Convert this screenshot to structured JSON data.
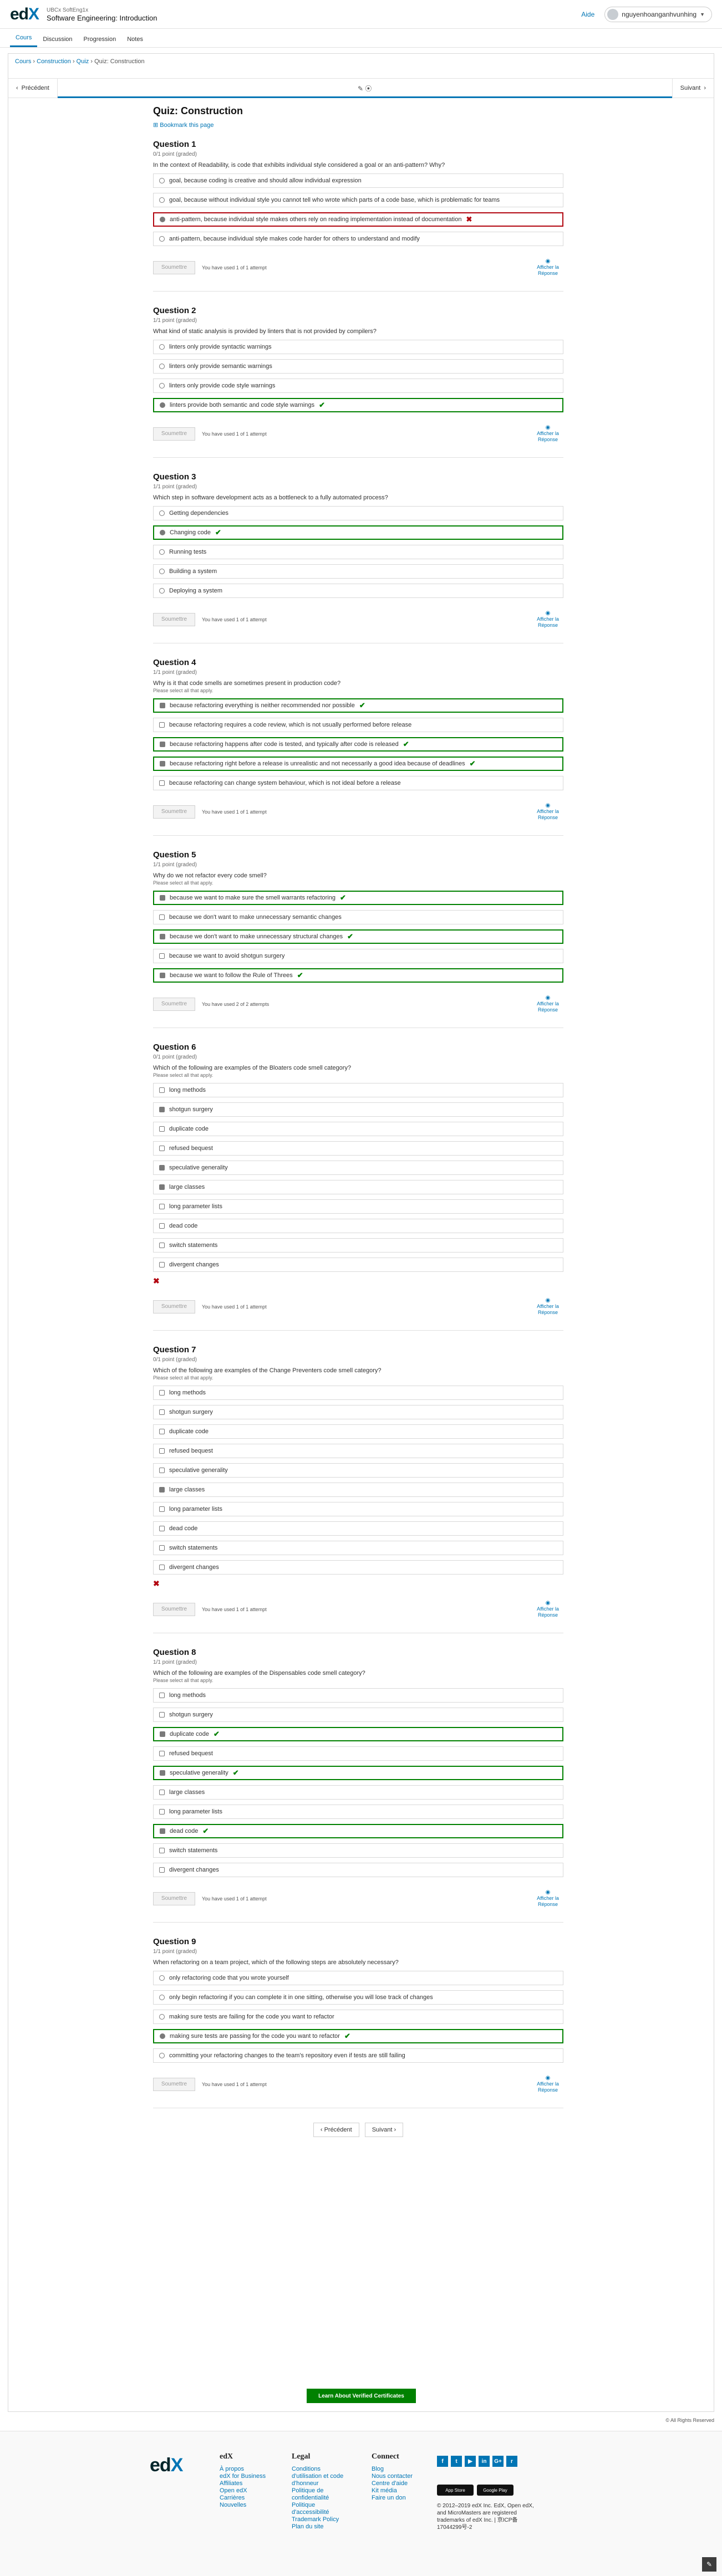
{
  "header": {
    "org": "UBCx SoftEng1x",
    "course_name": "Software Engineering: Introduction",
    "help": "Aide",
    "username": "nguyenhoanganhvunhing"
  },
  "course_tabs": [
    "Cours",
    "Discussion",
    "Progression",
    "Notes"
  ],
  "breadcrumb": [
    "Cours",
    "Construction",
    "Quiz",
    "Quiz: Construction"
  ],
  "sequence": {
    "prev": "Précédent",
    "next": "Suivant",
    "mid_icon": "✎ ⦿"
  },
  "unit": {
    "title": "Quiz: Construction",
    "bookmark": "Bookmark this page"
  },
  "common": {
    "submit": "Soumettre",
    "show_answer": "Afficher la Réponse",
    "attempts_1": "You have used 1 of 1 attempt",
    "attempts_2": "You have used 2 of 2 attempts"
  },
  "questions": [
    {
      "title": "Question 1",
      "points": "0/1 point (graded)",
      "text": "In the context of Readability, is code that exhibits individual style considered a goal or an anti-pattern? Why?",
      "hint": "",
      "kind": "radio",
      "attempts_key": "attempts_1",
      "trailing_x": false,
      "options": [
        {
          "label": "goal, because coding is creative and should allow individual expression",
          "state": ""
        },
        {
          "label": "goal, because without individual style you cannot tell who wrote which parts of a code base, which is problematic for teams",
          "state": ""
        },
        {
          "label": "anti-pattern, because individual style makes others rely on reading implementation instead of documentation",
          "state": "bad",
          "sel": true
        },
        {
          "label": "anti-pattern, because individual style makes code harder for others to understand and modify",
          "state": ""
        }
      ]
    },
    {
      "title": "Question 2",
      "points": "1/1 point (graded)",
      "text": "What kind of static analysis is provided by linters that is not provided by compilers?",
      "hint": "",
      "kind": "radio",
      "attempts_key": "attempts_1",
      "trailing_x": false,
      "options": [
        {
          "label": "linters only provide syntactic warnings",
          "state": ""
        },
        {
          "label": "linters only provide semantic warnings",
          "state": ""
        },
        {
          "label": "linters only provide code style warnings",
          "state": ""
        },
        {
          "label": "linters provide both semantic and code style warnings",
          "state": "ok",
          "sel": true
        }
      ]
    },
    {
      "title": "Question 3",
      "points": "1/1 point (graded)",
      "text": "Which step in software development acts as a bottleneck to a fully automated process?",
      "hint": "",
      "kind": "radio",
      "attempts_key": "attempts_1",
      "trailing_x": false,
      "options": [
        {
          "label": "Getting dependencies",
          "state": ""
        },
        {
          "label": "Changing code",
          "state": "ok",
          "sel": true
        },
        {
          "label": "Running tests",
          "state": ""
        },
        {
          "label": "Building a system",
          "state": ""
        },
        {
          "label": "Deploying a system",
          "state": ""
        }
      ]
    },
    {
      "title": "Question 4",
      "points": "1/1 point (graded)",
      "text": "Why is it that code smells are sometimes present in production code?",
      "hint": "Please select all that apply.",
      "kind": "check",
      "attempts_key": "attempts_1",
      "trailing_x": false,
      "options": [
        {
          "label": "because refactoring everything is neither recommended nor possible",
          "state": "ok",
          "sel": true
        },
        {
          "label": "because refactoring requires a code review, which is not usually performed before release",
          "state": ""
        },
        {
          "label": "because refactoring happens after code is tested, and typically after code is released",
          "state": "ok",
          "sel": true
        },
        {
          "label": "because refactoring right before a release is unrealistic and not necessarily a good idea because of deadlines",
          "state": "ok",
          "sel": true
        },
        {
          "label": "because refactoring can change system behaviour, which is not ideal before a release",
          "state": ""
        }
      ]
    },
    {
      "title": "Question 5",
      "points": "1/1 point (graded)",
      "text": "Why do we not refactor every code smell?",
      "hint": "Please select all that apply.",
      "kind": "check",
      "attempts_key": "attempts_2",
      "trailing_x": false,
      "options": [
        {
          "label": "because we want to make sure the smell warrants refactoring",
          "state": "ok",
          "sel": true
        },
        {
          "label": "because we don't want to make unnecessary semantic changes",
          "state": ""
        },
        {
          "label": "because we don't want to make unnecessary structural changes",
          "state": "ok",
          "sel": true
        },
        {
          "label": "because we want to avoid shotgun surgery",
          "state": ""
        },
        {
          "label": "because we want to follow the Rule of Threes",
          "state": "ok",
          "sel": true
        }
      ]
    },
    {
      "title": "Question 6",
      "points": "0/1 point (graded)",
      "text": "Which of the following are examples of the Bloaters code smell category?",
      "hint": "Please select all that apply.",
      "kind": "check",
      "attempts_key": "attempts_1",
      "trailing_x": true,
      "options": [
        {
          "label": "long methods",
          "state": ""
        },
        {
          "label": "shotgun surgery",
          "state": "",
          "sel": true
        },
        {
          "label": "duplicate code",
          "state": ""
        },
        {
          "label": "refused bequest",
          "state": ""
        },
        {
          "label": "speculative generality",
          "state": "",
          "sel": true
        },
        {
          "label": "large classes",
          "state": "",
          "sel": true
        },
        {
          "label": "long parameter lists",
          "state": ""
        },
        {
          "label": "dead code",
          "state": ""
        },
        {
          "label": "switch statements",
          "state": ""
        },
        {
          "label": "divergent changes",
          "state": ""
        }
      ]
    },
    {
      "title": "Question 7",
      "points": "0/1 point (graded)",
      "text": "Which of the following are examples of the Change Preventers code smell category?",
      "hint": "Please select all that apply.",
      "kind": "check",
      "attempts_key": "attempts_1",
      "trailing_x": true,
      "options": [
        {
          "label": "long methods",
          "state": ""
        },
        {
          "label": "shotgun surgery",
          "state": ""
        },
        {
          "label": "duplicate code",
          "state": ""
        },
        {
          "label": "refused bequest",
          "state": ""
        },
        {
          "label": "speculative generality",
          "state": ""
        },
        {
          "label": "large classes",
          "state": "",
          "sel": true
        },
        {
          "label": "long parameter lists",
          "state": ""
        },
        {
          "label": "dead code",
          "state": ""
        },
        {
          "label": "switch statements",
          "state": ""
        },
        {
          "label": "divergent changes",
          "state": ""
        }
      ]
    },
    {
      "title": "Question 8",
      "points": "1/1 point (graded)",
      "text": "Which of the following are examples of the Dispensables code smell category?",
      "hint": "Please select all that apply.",
      "kind": "check",
      "attempts_key": "attempts_1",
      "trailing_x": false,
      "options": [
        {
          "label": "long methods",
          "state": ""
        },
        {
          "label": "shotgun surgery",
          "state": ""
        },
        {
          "label": "duplicate code",
          "state": "ok",
          "sel": true
        },
        {
          "label": "refused bequest",
          "state": ""
        },
        {
          "label": "speculative generality",
          "state": "ok",
          "sel": true
        },
        {
          "label": "large classes",
          "state": ""
        },
        {
          "label": "long parameter lists",
          "state": ""
        },
        {
          "label": "dead code",
          "state": "ok",
          "sel": true
        },
        {
          "label": "switch statements",
          "state": ""
        },
        {
          "label": "divergent changes",
          "state": ""
        }
      ]
    },
    {
      "title": "Question 9",
      "points": "1/1 point (graded)",
      "text": "When refactoring on a team project, which of the following steps are absolutely necessary?",
      "hint": "",
      "kind": "radio",
      "attempts_key": "attempts_1",
      "trailing_x": false,
      "options": [
        {
          "label": "only refactoring code that you wrote yourself",
          "state": ""
        },
        {
          "label": "only begin refactoring if you can complete it in one sitting, otherwise you will lose track of changes",
          "state": ""
        },
        {
          "label": "making sure tests are failing for the code you want to refactor",
          "state": ""
        },
        {
          "label": "making sure tests are passing for the code you want to refactor",
          "state": "ok",
          "sel": true
        },
        {
          "label": "committing your refactoring changes to the team's repository even if tests are still failing",
          "state": ""
        }
      ]
    }
  ],
  "bottom_nav": {
    "prev": "Précédent",
    "next": "Suivant"
  },
  "cert_button": "Learn About Verified Certificates",
  "rights": "© All Rights Reserved",
  "footer": {
    "logo": "edX",
    "edx_title": "edX",
    "edx_links": [
      "À propos",
      "edX for Business",
      "Affiliates",
      "Open edX",
      "Carrières",
      "Nouvelles"
    ],
    "legal_title": "Legal",
    "legal_links": [
      "Conditions",
      "d'utilisation et code",
      "d'honneur",
      "Politique de",
      "confidentialité",
      "Politique",
      "d'accessibilité",
      "Trademark Policy",
      "Plan du site"
    ],
    "connect_title": "Connect",
    "connect_links": [
      "Blog",
      "Nous contacter",
      "Centre d'aide",
      "Kit média",
      "Faire un don"
    ],
    "social": [
      "f",
      "t",
      "▶",
      "in",
      "G+",
      "r"
    ],
    "stores": [
      "App Store",
      "Google Play"
    ],
    "copyright": "© 2012–2019 edX Inc. EdX, Open edX, and MicroMasters are registered trademarks of edX Inc. | 京ICP备17044299号-2"
  },
  "colors": {
    "accent": "#0075b4",
    "correct": "#008100",
    "incorrect": "#b20610"
  }
}
